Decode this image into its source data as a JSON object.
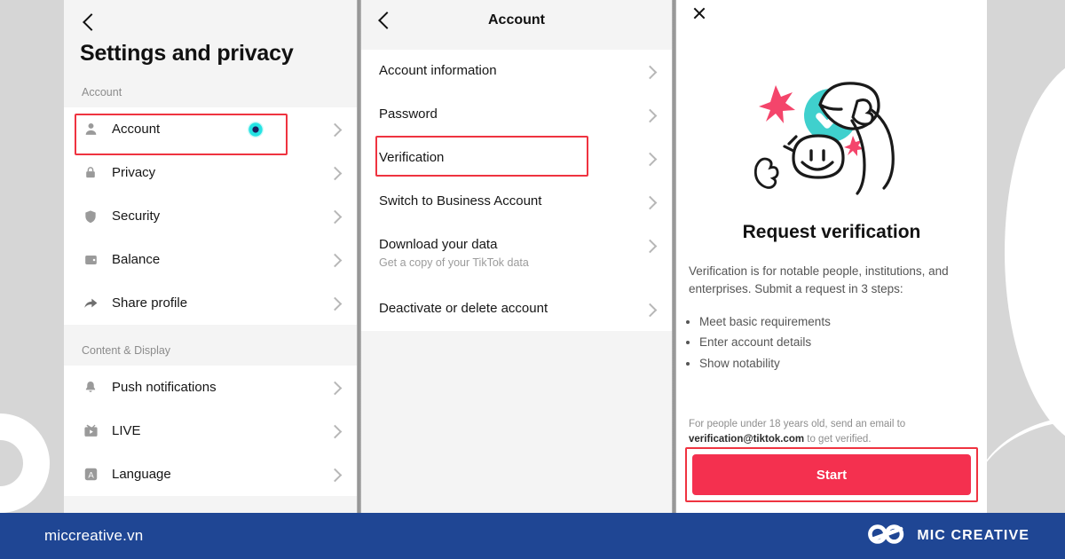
{
  "theme": {
    "background": "#d6d6d6",
    "panel_bg": "#ffffff",
    "panel_header_bg": "#f4f4f4",
    "highlight_red": "#ef3340",
    "tiktok_red": "#f4304f",
    "brandbar_blue": "#1f4694",
    "verified_teal": "#3fd0cd",
    "badge_navy": "#1b1f5e"
  },
  "settings_panel": {
    "back_icon": "chevron-left-icon",
    "title": "Settings and privacy",
    "sections": [
      {
        "heading": "Account",
        "items": [
          {
            "label": "Account",
            "icon": "person-icon",
            "badge": true,
            "highlighted": true
          },
          {
            "label": "Privacy",
            "icon": "lock-icon",
            "badge": false,
            "highlighted": false
          },
          {
            "label": "Security",
            "icon": "shield-icon",
            "badge": false,
            "highlighted": false
          },
          {
            "label": "Balance",
            "icon": "wallet-icon",
            "badge": false,
            "highlighted": false
          },
          {
            "label": "Share profile",
            "icon": "share-arrow-icon",
            "badge": false,
            "highlighted": false
          }
        ]
      },
      {
        "heading": "Content & Display",
        "items": [
          {
            "label": "Push notifications",
            "icon": "bell-icon",
            "badge": false,
            "highlighted": false
          },
          {
            "label": "LIVE",
            "icon": "live-broadcast-icon",
            "badge": false,
            "highlighted": false
          },
          {
            "label": "Language",
            "icon": "language-a-icon",
            "badge": false,
            "highlighted": false
          }
        ]
      }
    ]
  },
  "account_panel": {
    "back_icon": "chevron-left-icon",
    "title": "Account",
    "items": [
      {
        "label": "Account information",
        "sub": "",
        "highlighted": false
      },
      {
        "label": "Password",
        "sub": "",
        "highlighted": false
      },
      {
        "label": "Verification",
        "sub": "",
        "highlighted": true
      },
      {
        "label": "Switch to Business Account",
        "sub": "",
        "highlighted": false
      },
      {
        "label": "Download your data",
        "sub": "Get a copy of your TikTok data",
        "highlighted": false
      },
      {
        "label": "Deactivate or delete account",
        "sub": "",
        "highlighted": false
      }
    ]
  },
  "verify_panel": {
    "close_icon": "close-x-icon",
    "illustration": "person-tipping-hat-with-verified-badge-illustration",
    "title": "Request verification",
    "description": "Verification is for notable people, institutions, and enterprises. Submit a request in 3 steps:",
    "steps": [
      "Meet basic requirements",
      "Enter account details",
      "Show notability"
    ],
    "minor_note_prefix": "For people under 18 years old, send an email to ",
    "minor_note_email": "verification@tiktok.com",
    "minor_note_suffix": " to get verified.",
    "start_label": "Start",
    "start_highlighted": true
  },
  "brandbar": {
    "site": "miccreative.vn",
    "logo_icon": "infinity-loop-logo-icon",
    "logo_text": "MIC CREATIVE"
  }
}
